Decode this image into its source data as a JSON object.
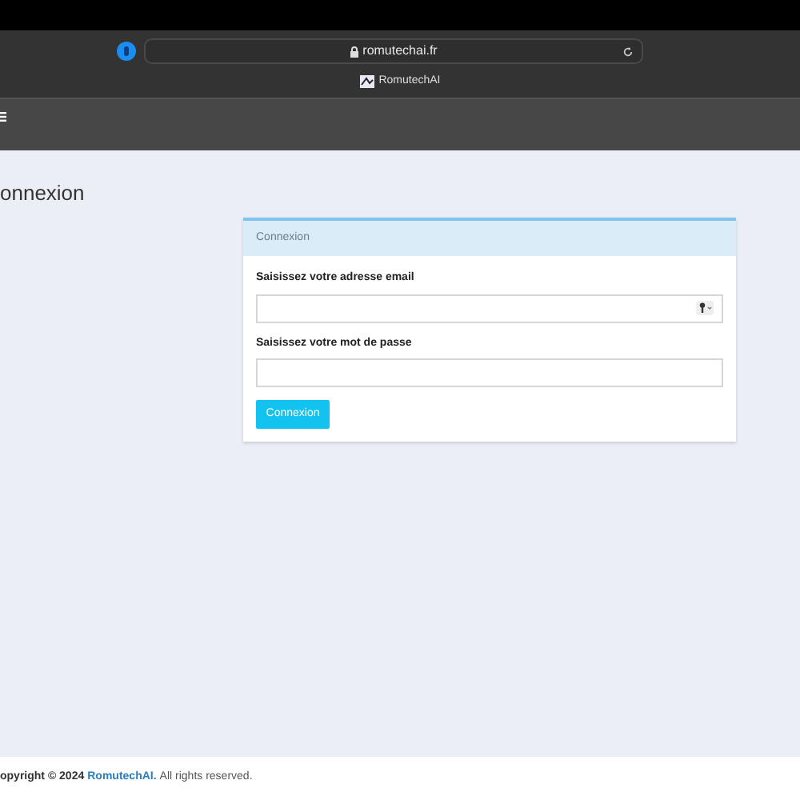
{
  "browser": {
    "url": "romutechai.fr",
    "tab_title": "RomutechAI"
  },
  "page_title": "onnexion",
  "card": {
    "header": "Connexion",
    "fields": [
      {
        "label": "Saisissez votre adresse email",
        "kind": "email"
      },
      {
        "label": "Saisissez votre mot de passe",
        "kind": "password"
      }
    ],
    "button": "Connexion"
  },
  "footer": {
    "prefix": "opyright © 2024",
    "link": "RomutechAI.",
    "suffix": "All rights reserved."
  }
}
